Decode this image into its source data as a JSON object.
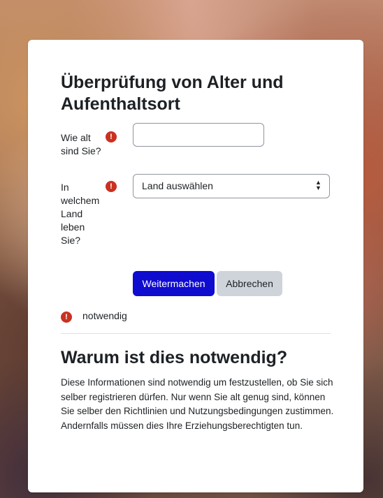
{
  "form": {
    "title": "Überprüfung von Alter und Aufenthaltsort",
    "age_label": "Wie alt sind Sie?",
    "age_value": "",
    "country_label": "In welchem Land leben Sie?",
    "country_selected": "Land auswählen",
    "required_icon": "exclamation-circle-icon",
    "continue_label": "Weitermachen",
    "cancel_label": "Abbrechen",
    "required_note": "notwendig"
  },
  "why": {
    "heading": "Warum ist dies notwendig?",
    "text": "Diese Informationen sind notwendig um festzustellen, ob Sie sich selber registrieren dürfen. Nur wenn Sie alt genug sind, können Sie selber den Richtlinien und Nutzungsbedingungen zustimmen. Andernfalls müssen dies Ihre Erziehungsberechtigten tun."
  },
  "colors": {
    "primary": "#0f0bcf",
    "required": "#ca3120",
    "secondary_button": "#ced4da"
  }
}
